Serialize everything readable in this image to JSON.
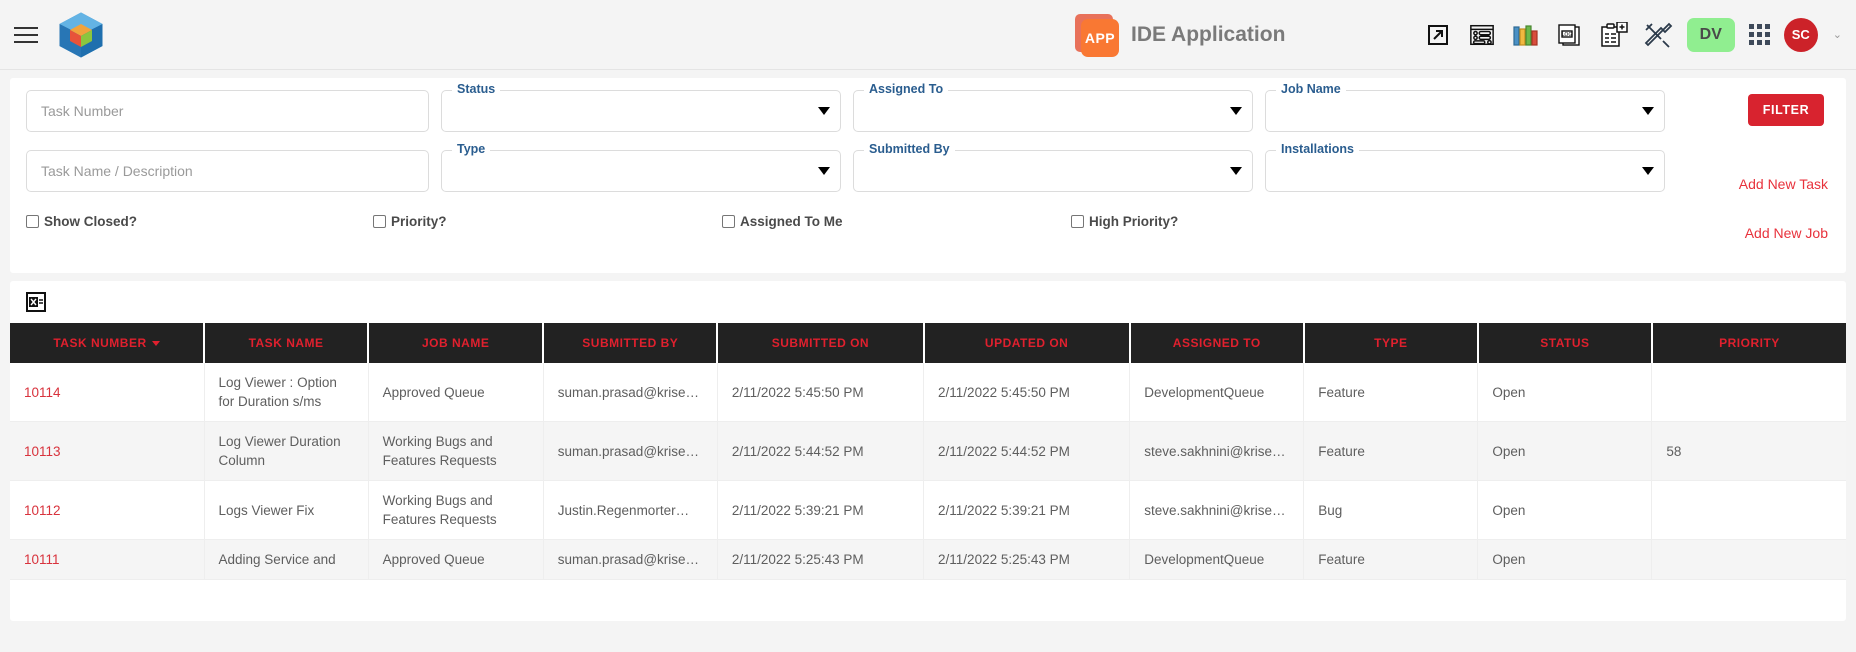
{
  "header": {
    "menu_icon": "hamburger-menu-icon",
    "brand_icon": "cube-logo-icon",
    "app_badge_text": "APP",
    "app_title": "IDE Application",
    "icons": [
      {
        "name": "external-link-icon"
      },
      {
        "name": "requests-list-icon"
      },
      {
        "name": "books-library-icon"
      },
      {
        "name": "log-file-icon"
      },
      {
        "name": "add-clipboard-icon"
      },
      {
        "name": "tools-icon"
      }
    ],
    "env_badge": "DV",
    "apps_grid_icon": "apps-grid-icon",
    "avatar_initials": "SC",
    "avatar_caret": "⌄"
  },
  "filters": {
    "task_number": {
      "label": "Task Number",
      "placeholder": "Task Number",
      "value": ""
    },
    "task_name": {
      "label": "Task Name / Description",
      "placeholder": "Task Name / Description",
      "value": ""
    },
    "status": {
      "label": "Status",
      "value": ""
    },
    "type": {
      "label": "Type",
      "value": ""
    },
    "assigned_to": {
      "label": "Assigned To",
      "value": ""
    },
    "submitted_by": {
      "label": "Submitted By",
      "value": ""
    },
    "job_name": {
      "label": "Job Name",
      "value": ""
    },
    "installations": {
      "label": "Installations",
      "value": ""
    },
    "checkboxes": [
      {
        "label": "Show Closed?",
        "checked": false
      },
      {
        "label": "Priority?",
        "checked": false
      },
      {
        "label": "Assigned To Me",
        "checked": false
      },
      {
        "label": "High Priority?",
        "checked": false
      }
    ],
    "filter_button": "FILTER",
    "add_new_task": "Add New Task",
    "add_new_job": "Add New Job"
  },
  "table": {
    "export_icon": "excel-export-icon",
    "sort_column": "TASK NUMBER",
    "sort_direction": "desc",
    "columns": [
      "TASK NUMBER",
      "TASK NAME",
      "JOB NAME",
      "SUBMITTED BY",
      "SUBMITTED ON",
      "UPDATED ON",
      "ASSIGNED TO",
      "TYPE",
      "STATUS",
      "PRIORITY"
    ],
    "rows": [
      {
        "task_number": "10114",
        "task_name": "Log Viewer : Option for Duration s/ms",
        "job_name": "Approved Queue",
        "submitted_by": "suman.prasad@krise…",
        "submitted_on": "2/11/2022 5:45:50 PM",
        "updated_on": "2/11/2022 5:45:50 PM",
        "assigned_to": "DevelopmentQueue",
        "type": "Feature",
        "status": "Open",
        "priority": ""
      },
      {
        "task_number": "10113",
        "task_name": "Log Viewer Duration Column",
        "job_name": "Working Bugs and Features Requests",
        "submitted_by": "suman.prasad@krise…",
        "submitted_on": "2/11/2022 5:44:52 PM",
        "updated_on": "2/11/2022 5:44:52 PM",
        "assigned_to": "steve.sakhnini@krise…",
        "type": "Feature",
        "status": "Open",
        "priority": "58"
      },
      {
        "task_number": "10112",
        "task_name": "Logs Viewer Fix",
        "job_name": "Working Bugs and Features Requests",
        "submitted_by": "Justin.Regenmorter…",
        "submitted_on": "2/11/2022 5:39:21 PM",
        "updated_on": "2/11/2022 5:39:21 PM",
        "assigned_to": "steve.sakhnini@krise…",
        "type": "Bug",
        "status": "Open",
        "priority": ""
      },
      {
        "task_number": "10111",
        "task_name": "Adding Service and",
        "job_name": "Approved Queue",
        "submitted_by": "suman.prasad@krise…",
        "submitted_on": "2/11/2022 5:25:43 PM",
        "updated_on": "2/11/2022 5:25:43 PM",
        "assigned_to": "DevelopmentQueue",
        "type": "Feature",
        "status": "Open",
        "priority": ""
      }
    ]
  },
  "colors": {
    "accent_red": "#d8232f",
    "header_red_text": "#e0202e",
    "table_header_bg": "#222222",
    "legend_blue": "#2a5d8f",
    "env_badge_green": "#90ee90",
    "avatar_red": "#cc2229"
  }
}
